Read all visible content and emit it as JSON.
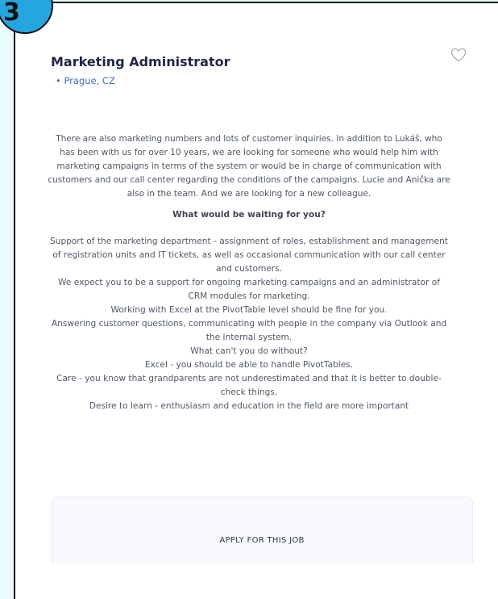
{
  "step": {
    "number": "3"
  },
  "job": {
    "title": "Marketing Administrator",
    "location": "• Prague, CZ"
  },
  "description": {
    "intro": "There are also marketing numbers and lots of customer inquiries. In addition to Lukáš, who has been with us for over 10 years, we are looking for someone who would help him with marketing campaigns in terms of the system or would be in charge of communication with customers and our call center regarding the conditions of the campaigns. Lucie and Anička are also in the team. And we are looking for a new colleague.",
    "heading": "What would be waiting for you?",
    "lines": [
      "Support of the marketing department - assignment of roles, establishment and management of registration units and IT tickets, as well as occasional communication with our call center and customers.",
      "We expect you to be a support for ongoing marketing campaigns and an administrator of CRM modules for marketing.",
      "Working with Excel at the PivotTable level should be fine for you.",
      "Answering customer questions, communicating with people in the company via Outlook and the internal system.",
      "What can't you do without?",
      "Excel - you should be able to handle PivotTables.",
      "Care - you know that grandparents are not underestimated and that it is better to double-check things.",
      "Desire to learn - enthusiasm and education in the field are more important"
    ]
  },
  "apply": {
    "label": "APPLY FOR THIS JOB"
  },
  "icons": {
    "favorite": "heart-outline-icon"
  },
  "colors": {
    "background": "#eafbff",
    "badge": "#26a6e0",
    "title": "#1f2746",
    "location": "#3c6fc4",
    "body_text": "#505866",
    "card": "#f7f9fc"
  }
}
